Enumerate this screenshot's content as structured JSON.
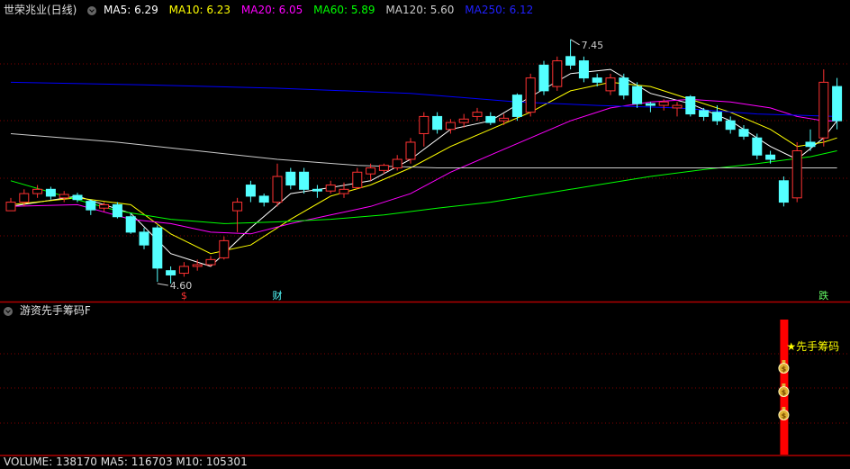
{
  "main_header": {
    "title": "世荣兆业(日线)",
    "ma": [
      {
        "label": "MA5: 6.29",
        "color": "#ffffff"
      },
      {
        "label": "MA10: 6.23",
        "color": "#ffff00"
      },
      {
        "label": "MA20: 6.05",
        "color": "#ff00ff"
      },
      {
        "label": "MA60: 5.89",
        "color": "#00ff00"
      },
      {
        "label": "MA120: 5.60",
        "color": "#cccccc"
      },
      {
        "label": "MA250: 6.12",
        "color": "#0000ff"
      }
    ]
  },
  "sub_header": {
    "title": "游资先手筹码F"
  },
  "volume_header": {
    "text": "VOLUME: 138170 MA5: 116703 M10: 105301"
  },
  "colors": {
    "up": "#ff3232",
    "down": "#54ffff",
    "bg": "#000000",
    "grid": "#800000",
    "axis": "#b00000"
  },
  "chart_data": [
    {
      "type": "candlestick",
      "title": "世荣兆业(日线)",
      "price_range": [
        4.4,
        7.7
      ],
      "annotations": {
        "high": {
          "text": "7.45",
          "value": 7.45
        },
        "low": {
          "text": "4.60",
          "value": 4.6
        },
        "markers": [
          {
            "text": "$",
            "index": 13,
            "color": "#ff3232"
          },
          {
            "text": "财",
            "index": 20,
            "color": "#54ffff"
          },
          {
            "text": "跌",
            "index": 61,
            "color": "#66ff66"
          }
        ]
      },
      "candles": [
        [
          5.45,
          5.55,
          5.45,
          5.6
        ],
        [
          5.55,
          5.65,
          5.5,
          5.7
        ],
        [
          5.65,
          5.7,
          5.6,
          5.75
        ],
        [
          5.7,
          5.62,
          5.58,
          5.73
        ],
        [
          5.6,
          5.64,
          5.55,
          5.68
        ],
        [
          5.63,
          5.58,
          5.55,
          5.66
        ],
        [
          5.56,
          5.46,
          5.4,
          5.58
        ],
        [
          5.48,
          5.52,
          5.44,
          5.55
        ],
        [
          5.52,
          5.38,
          5.36,
          5.55
        ],
        [
          5.38,
          5.2,
          5.18,
          5.42
        ],
        [
          5.2,
          5.05,
          5.0,
          5.25
        ],
        [
          5.25,
          4.78,
          4.62,
          5.28
        ],
        [
          4.75,
          4.7,
          4.6,
          4.8
        ],
        [
          4.72,
          4.8,
          4.68,
          4.85
        ],
        [
          4.8,
          4.82,
          4.75,
          4.88
        ],
        [
          4.82,
          4.88,
          4.8,
          4.92
        ],
        [
          4.9,
          5.1,
          4.88,
          5.15
        ],
        [
          5.45,
          5.55,
          5.2,
          5.6
        ],
        [
          5.75,
          5.62,
          5.55,
          5.8
        ],
        [
          5.62,
          5.55,
          5.5,
          5.65
        ],
        [
          5.55,
          5.85,
          5.5,
          6.0
        ],
        [
          5.9,
          5.75,
          5.7,
          5.95
        ],
        [
          5.9,
          5.7,
          5.65,
          5.95
        ],
        [
          5.7,
          5.68,
          5.6,
          5.75
        ],
        [
          5.68,
          5.75,
          5.65,
          5.8
        ],
        [
          5.65,
          5.7,
          5.6,
          5.78
        ],
        [
          5.72,
          5.9,
          5.7,
          5.95
        ],
        [
          5.88,
          5.95,
          5.8,
          6.0
        ],
        [
          5.92,
          5.98,
          5.88,
          6.0
        ],
        [
          5.95,
          6.05,
          5.92,
          6.1
        ],
        [
          6.05,
          6.25,
          6.0,
          6.3
        ],
        [
          6.35,
          6.55,
          6.2,
          6.6
        ],
        [
          6.55,
          6.4,
          6.35,
          6.6
        ],
        [
          6.4,
          6.48,
          6.35,
          6.52
        ],
        [
          6.48,
          6.52,
          6.42,
          6.58
        ],
        [
          6.55,
          6.6,
          6.5,
          6.65
        ],
        [
          6.55,
          6.48,
          6.45,
          6.6
        ],
        [
          6.5,
          6.53,
          6.45,
          6.58
        ],
        [
          6.8,
          6.55,
          6.5,
          6.82
        ],
        [
          6.6,
          7.0,
          6.55,
          7.05
        ],
        [
          7.15,
          6.85,
          6.8,
          7.2
        ],
        [
          6.9,
          7.2,
          6.85,
          7.25
        ],
        [
          7.25,
          7.15,
          7.1,
          7.45
        ],
        [
          7.2,
          7.0,
          6.95,
          7.25
        ],
        [
          7.0,
          6.95,
          6.9,
          7.05
        ],
        [
          6.85,
          7.0,
          6.8,
          7.05
        ],
        [
          7.0,
          6.8,
          6.75,
          7.05
        ],
        [
          6.9,
          6.7,
          6.65,
          6.95
        ],
        [
          6.7,
          6.68,
          6.6,
          6.72
        ],
        [
          6.68,
          6.72,
          6.62,
          6.75
        ],
        [
          6.65,
          6.68,
          6.55,
          6.72
        ],
        [
          6.78,
          6.58,
          6.55,
          6.8
        ],
        [
          6.62,
          6.55,
          6.5,
          6.65
        ],
        [
          6.6,
          6.5,
          6.45,
          6.68
        ],
        [
          6.5,
          6.4,
          6.35,
          6.55
        ],
        [
          6.4,
          6.32,
          6.28,
          6.45
        ],
        [
          6.3,
          6.1,
          6.05,
          6.35
        ],
        [
          6.1,
          6.05,
          6.0,
          6.15
        ],
        [
          5.8,
          5.55,
          5.5,
          5.85
        ],
        [
          5.6,
          6.15,
          5.55,
          6.25
        ],
        [
          6.25,
          6.2,
          6.15,
          6.4
        ],
        [
          6.3,
          6.95,
          6.2,
          7.1
        ],
        [
          6.9,
          6.5,
          6.4,
          7.0
        ]
      ],
      "series": [
        {
          "name": "MA5",
          "color": "#ffffff",
          "points": [
            [
              0,
              5.5
            ],
            [
              5,
              5.62
            ],
            [
              9,
              5.42
            ],
            [
              12,
              4.95
            ],
            [
              15,
              4.8
            ],
            [
              18,
              5.25
            ],
            [
              21,
              5.65
            ],
            [
              24,
              5.72
            ],
            [
              27,
              5.8
            ],
            [
              30,
              6.05
            ],
            [
              33,
              6.4
            ],
            [
              36,
              6.5
            ],
            [
              39,
              6.78
            ],
            [
              42,
              7.05
            ],
            [
              45,
              7.1
            ],
            [
              48,
              6.82
            ],
            [
              51,
              6.7
            ],
            [
              54,
              6.5
            ],
            [
              57,
              6.2
            ],
            [
              59,
              6.05
            ],
            [
              61,
              6.3
            ],
            [
              62,
              6.5
            ]
          ]
        },
        {
          "name": "MA10",
          "color": "#ffff00",
          "points": [
            [
              0,
              5.52
            ],
            [
              5,
              5.6
            ],
            [
              9,
              5.52
            ],
            [
              12,
              5.18
            ],
            [
              15,
              4.95
            ],
            [
              18,
              5.05
            ],
            [
              21,
              5.35
            ],
            [
              24,
              5.62
            ],
            [
              27,
              5.75
            ],
            [
              30,
              5.95
            ],
            [
              33,
              6.2
            ],
            [
              36,
              6.4
            ],
            [
              39,
              6.6
            ],
            [
              42,
              6.85
            ],
            [
              45,
              6.95
            ],
            [
              48,
              6.9
            ],
            [
              51,
              6.75
            ],
            [
              54,
              6.6
            ],
            [
              57,
              6.4
            ],
            [
              59,
              6.2
            ],
            [
              61,
              6.25
            ],
            [
              62,
              6.3
            ]
          ]
        },
        {
          "name": "MA20",
          "color": "#ff00ff",
          "points": [
            [
              0,
              5.5
            ],
            [
              5,
              5.52
            ],
            [
              9,
              5.35
            ],
            [
              12,
              5.3
            ],
            [
              15,
              5.2
            ],
            [
              18,
              5.18
            ],
            [
              21,
              5.3
            ],
            [
              24,
              5.4
            ],
            [
              27,
              5.5
            ],
            [
              30,
              5.65
            ],
            [
              33,
              5.9
            ],
            [
              36,
              6.1
            ],
            [
              39,
              6.3
            ],
            [
              42,
              6.5
            ],
            [
              45,
              6.65
            ],
            [
              48,
              6.72
            ],
            [
              51,
              6.75
            ],
            [
              54,
              6.72
            ],
            [
              57,
              6.65
            ],
            [
              59,
              6.55
            ],
            [
              61,
              6.5
            ],
            [
              62,
              6.5
            ]
          ]
        },
        {
          "name": "MA60",
          "color": "#00ff00",
          "points": [
            [
              0,
              5.8
            ],
            [
              4,
              5.62
            ],
            [
              8,
              5.45
            ],
            [
              12,
              5.35
            ],
            [
              16,
              5.3
            ],
            [
              20,
              5.32
            ],
            [
              24,
              5.35
            ],
            [
              28,
              5.4
            ],
            [
              32,
              5.48
            ],
            [
              36,
              5.55
            ],
            [
              40,
              5.65
            ],
            [
              44,
              5.75
            ],
            [
              48,
              5.85
            ],
            [
              52,
              5.93
            ],
            [
              56,
              6.0
            ],
            [
              60,
              6.08
            ],
            [
              62,
              6.15
            ]
          ]
        },
        {
          "name": "MA120",
          "color": "#cccccc",
          "points": [
            [
              0,
              6.35
            ],
            [
              8,
              6.25
            ],
            [
              14,
              6.15
            ],
            [
              20,
              6.05
            ],
            [
              26,
              5.98
            ],
            [
              32,
              5.95
            ],
            [
              38,
              5.95
            ],
            [
              44,
              5.95
            ],
            [
              50,
              5.95
            ],
            [
              56,
              5.95
            ],
            [
              62,
              5.95
            ]
          ]
        },
        {
          "name": "MA250",
          "color": "#0000ff",
          "points": [
            [
              0,
              6.95
            ],
            [
              10,
              6.92
            ],
            [
              20,
              6.88
            ],
            [
              30,
              6.82
            ],
            [
              38,
              6.72
            ],
            [
              44,
              6.68
            ],
            [
              50,
              6.65
            ],
            [
              56,
              6.58
            ],
            [
              62,
              6.55
            ]
          ]
        }
      ]
    },
    {
      "type": "bar",
      "title": "游资先手筹码F",
      "signal_index": 58,
      "annotation": "★先手筹码",
      "icons": [
        {
          "name": "money-bag-icon",
          "count": 3,
          "symbol": "$"
        }
      ]
    }
  ]
}
